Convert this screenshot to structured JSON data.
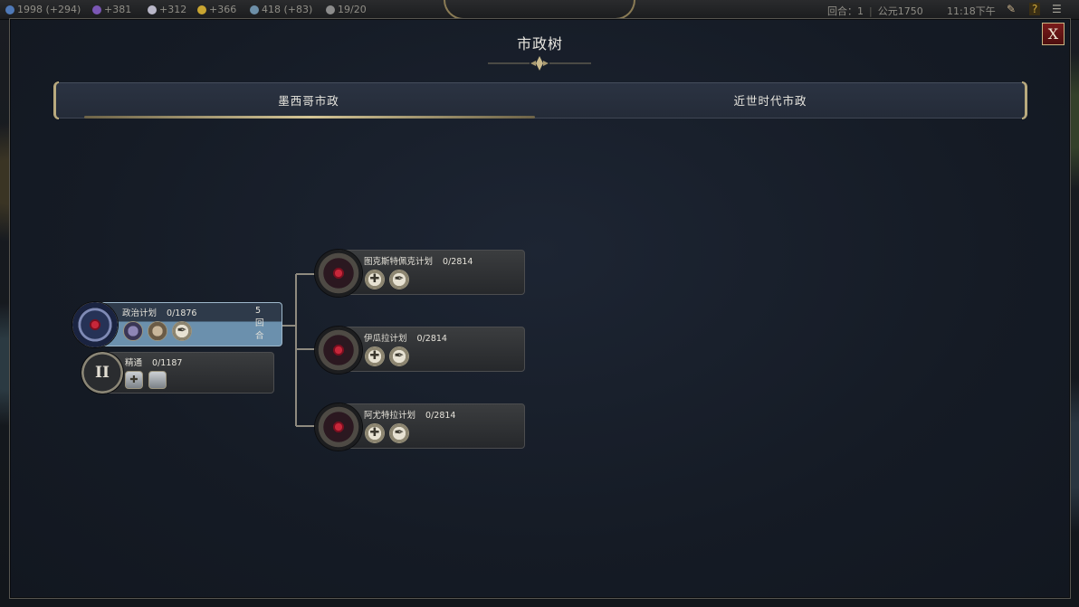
{
  "topbar": {
    "science": "1998 (+294)",
    "culture": "+381",
    "faith": "+312",
    "gold": "+366",
    "tourism": "418 (+83)",
    "era_score": "19/20",
    "turn_label": "回合：1",
    "year": "公元1750",
    "time": "11:18下午"
  },
  "modal": {
    "title": "市政树",
    "close_label": "X"
  },
  "tabs": [
    {
      "label": "墨西哥市政",
      "selected": true
    },
    {
      "label": "近世时代市政",
      "selected": false
    }
  ],
  "nodes": [
    {
      "name": "政治计划",
      "progress": "0/1876",
      "turns": "5回合",
      "active": true
    },
    {
      "name": "精通",
      "progress": "0/1187",
      "numeral": "II"
    },
    {
      "name": "图克斯特佩克计划",
      "progress": "0/2814"
    },
    {
      "name": "伊瓜拉计划",
      "progress": "0/2814"
    },
    {
      "name": "阿尤特拉计划",
      "progress": "0/2814"
    }
  ],
  "colors": {
    "accent_gold": "#d4c596",
    "active_blue": "#6b90ad",
    "close_red": "#7a1b1b"
  }
}
